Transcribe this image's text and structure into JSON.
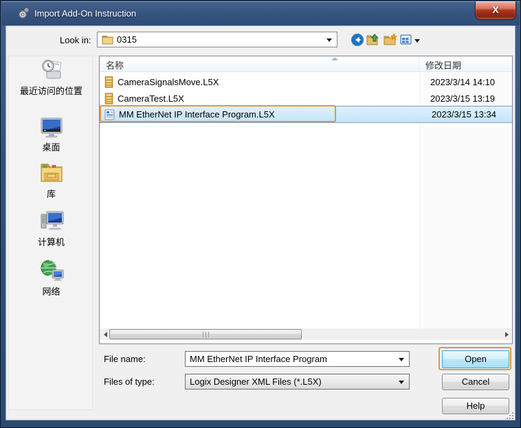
{
  "window": {
    "title": "Import Add-On Instruction",
    "close_glyph": "X"
  },
  "toolbar": {
    "look_in_label": "Look in:",
    "look_in_value": "0315"
  },
  "places": [
    {
      "label": "最近访问的位置",
      "icon": "recent-places"
    },
    {
      "label": "桌面",
      "icon": "desktop"
    },
    {
      "label": "库",
      "icon": "libraries"
    },
    {
      "label": "计算机",
      "icon": "computer"
    },
    {
      "label": "网络",
      "icon": "network"
    }
  ],
  "file_list": {
    "columns": {
      "name": "名称",
      "date": "修改日期"
    },
    "rows": [
      {
        "name": "CameraSignalsMove.L5X",
        "date": "2023/3/14 14:10",
        "icon": "ladder-file",
        "selected": false
      },
      {
        "name": "CameraTest.L5X",
        "date": "2023/3/15 13:19",
        "icon": "ladder-file",
        "selected": false
      },
      {
        "name": "MM EtherNet IP Interface Program.L5X",
        "date": "2023/3/15 13:34",
        "icon": "aoi-file",
        "selected": true
      }
    ]
  },
  "form": {
    "file_name_label": "File name:",
    "file_name_value": "MM EtherNet IP Interface Program",
    "files_of_type_label": "Files of type:",
    "files_of_type_value": "Logix Designer XML Files (*.L5X)"
  },
  "buttons": {
    "open": "Open",
    "cancel": "Cancel",
    "help": "Help"
  },
  "colors": {
    "titlebar_blue": "#33517c",
    "close_red": "#ad3420",
    "selection_blue": "#cde8f9",
    "annotation_orange": "#e09a3c",
    "default_button_blue": "#bfe7f9",
    "content_gray": "#f0f0f0"
  }
}
